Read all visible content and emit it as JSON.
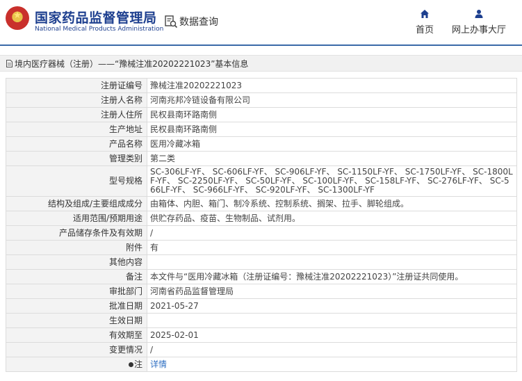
{
  "header": {
    "brand_cn": "国家药品监督管理局",
    "brand_en": "National Medical Products Administration",
    "search_label": "数据查询",
    "nav_home": "首页",
    "nav_online": "网上办事大厅"
  },
  "breadcrumb": {
    "text": "境内医疗器械（注册）——“豫械注准20202221023”基本信息"
  },
  "detail": {
    "rows": [
      {
        "label": "注册证编号",
        "value": "豫械注准20202221023"
      },
      {
        "label": "注册人名称",
        "value": "河南兆邦冷链设备有限公司"
      },
      {
        "label": "注册人住所",
        "value": "民权县南环路南侧"
      },
      {
        "label": "生产地址",
        "value": "民权县南环路南侧"
      },
      {
        "label": "产品名称",
        "value": "医用冷藏冰箱"
      },
      {
        "label": "管理类别",
        "value": "第二类"
      },
      {
        "label": "型号规格",
        "value": "SC-306LF-YF、 SC-606LF-YF、 SC-906LF-YF、 SC-1150LF-YF、 SC-1750LF-YF、 SC-1800LF-YF、 SC-2250LF-YF、 SC-50LF-YF、 SC-100LF-YF、 SC-158LF-YF、 SC-276LF-YF、 SC-566LF-YF、 SC-966LF-YF、 SC-920LF-YF、 SC-1300LF-YF"
      },
      {
        "label": "结构及组成/主要组成成分",
        "value": "由箱体、内胆、箱门、制冷系统、控制系统、搁架、拉手、脚轮组成。"
      },
      {
        "label": "适用范围/预期用途",
        "value": "供贮存药品、疫苗、生物制品、试剂用。"
      },
      {
        "label": "产品储存条件及有效期",
        "value": "/"
      },
      {
        "label": "附件",
        "value": "有"
      },
      {
        "label": "其他内容",
        "value": ""
      },
      {
        "label": "备注",
        "value": "本文件与“医用冷藏冰箱（注册证编号：豫械注准20202221023）”注册证共同使用。"
      },
      {
        "label": "审批部门",
        "value": "河南省药品监督管理局"
      },
      {
        "label": "批准日期",
        "value": "2021-05-27"
      },
      {
        "label": "生效日期",
        "value": ""
      },
      {
        "label": "有效期至",
        "value": "2025-02-01"
      },
      {
        "label": "变更情况",
        "value": "/"
      }
    ],
    "note_label": "注",
    "note_link": "详情"
  }
}
